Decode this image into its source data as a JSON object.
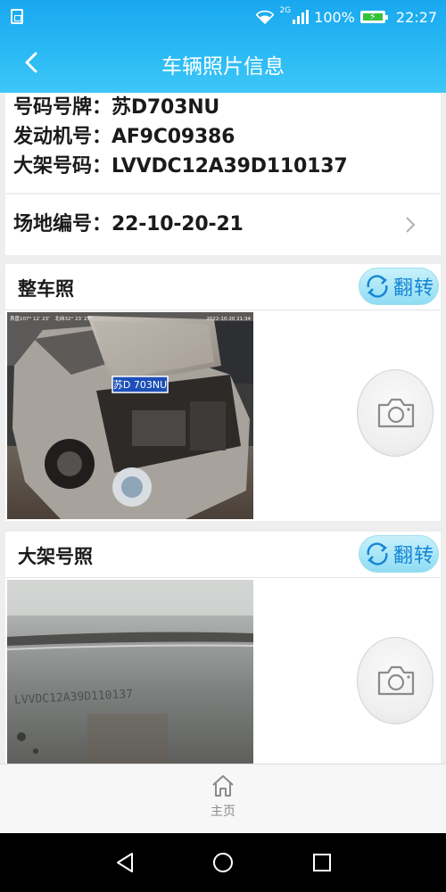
{
  "status_bar": {
    "network": "2G",
    "battery": "100%",
    "time": "22:27",
    "icons": [
      "sim-icon",
      "wifi-icon",
      "signal-icon",
      "battery-charging-icon"
    ]
  },
  "header": {
    "title": "车辆照片信息",
    "back_icon": "chevron-left-icon"
  },
  "vehicle": {
    "plate_label": "号码号牌：",
    "plate_value": "苏D703NU",
    "engine_label": "发动机号：",
    "engine_value": "AF9C09386",
    "frame_label": "大架号码：",
    "frame_value": "LVVDC12A39D110137"
  },
  "site": {
    "label": "场地编号：",
    "value": "22-10-20-21"
  },
  "cards": [
    {
      "title": "整车照",
      "flip_label": "翻转",
      "photo_overlay_left": "表盘107° 12′ 23″　北纬32° 23′ 25″",
      "photo_overlay_right": "2022-10-20 21:34",
      "plate_in_photo": "苏D 703NU"
    },
    {
      "title": "大架号照",
      "flip_label": "翻转",
      "stamped_text": "LVVDC12A39D110137"
    }
  ],
  "tabbar": {
    "home_label": "主页"
  },
  "colors": {
    "header_blue": "#29b9f4",
    "flip_text": "#1585d4",
    "battery_green": "#35c23d"
  }
}
